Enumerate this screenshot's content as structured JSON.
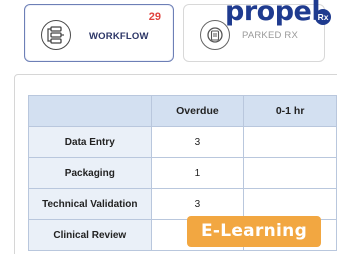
{
  "tabs": {
    "workflow": {
      "label": "WORKFLOW",
      "count": "29"
    },
    "parked": {
      "label": "PARKED RX"
    }
  },
  "logo": {
    "text": "propel",
    "badge": "Rx"
  },
  "table": {
    "headers": [
      "",
      "Overdue",
      "0-1 hr"
    ],
    "rows": [
      {
        "label": "Data Entry",
        "overdue": "3",
        "zero_one": ""
      },
      {
        "label": "Packaging",
        "overdue": "1",
        "zero_one": ""
      },
      {
        "label": "Technical Validation",
        "overdue": "3",
        "zero_one": ""
      },
      {
        "label": "Clinical Review",
        "overdue": "",
        "zero_one": ""
      }
    ]
  },
  "badge": {
    "label": "E-Learning"
  },
  "colors": {
    "brand": "#1f3b8f",
    "count": "#e0433f",
    "header_bg": "#d3e0f1",
    "badge_bg": "#f2a741"
  },
  "icons": {
    "workflow": "workflow-icon",
    "parked": "parked-rx-icon"
  }
}
